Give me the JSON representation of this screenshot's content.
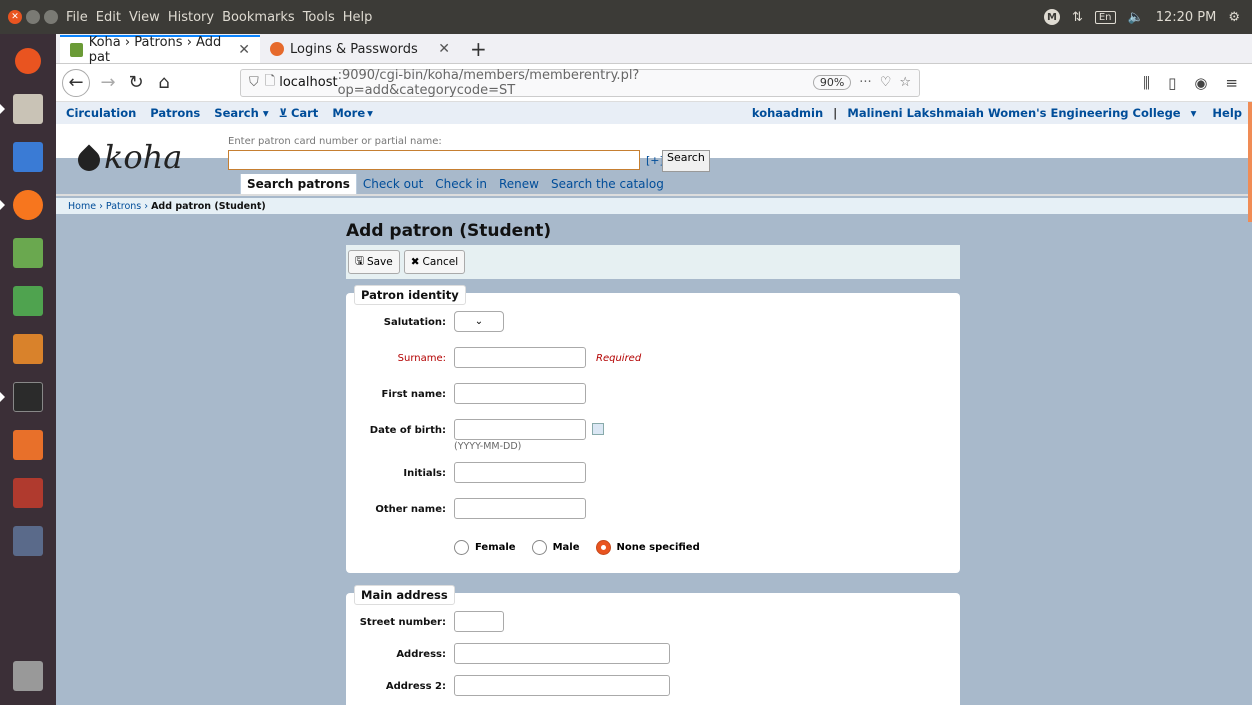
{
  "os": {
    "menus": [
      "File",
      "Edit",
      "View",
      "History",
      "Bookmarks",
      "Tools",
      "Help"
    ],
    "tray": {
      "m": "M",
      "lang": "En",
      "clock": "12:20 PM"
    }
  },
  "browser": {
    "tabs": [
      {
        "title": "Koha › Patrons › Add pat",
        "active": true
      },
      {
        "title": "Logins & Passwords",
        "active": false
      }
    ],
    "url_host": "localhost",
    "url_path": ":9090/cgi-bin/koha/members/memberentry.pl?op=add&categorycode=ST",
    "zoom": "90%"
  },
  "koha": {
    "nav": {
      "circulation": "Circulation",
      "patrons": "Patrons",
      "search": "Search",
      "cart": "Cart",
      "more": "More",
      "user": "kohaadmin",
      "library": "Malineni Lakshmaiah Women's Engineering College",
      "help": "Help"
    },
    "logo": "koha",
    "search_label": "Enter patron card number or partial name:",
    "plus": "[+]",
    "search_button": "Search",
    "subtabs": [
      "Search patrons",
      "Check out",
      "Check in",
      "Renew",
      "Search the catalog"
    ],
    "breadcrumbs": {
      "home": "Home",
      "patrons": "Patrons",
      "current": "Add patron (Student)"
    },
    "page_title": "Add patron (Student)",
    "toolbar": {
      "save": "Save",
      "cancel": "Cancel"
    },
    "identity": {
      "legend": "Patron identity",
      "salutation": "Salutation:",
      "surname": "Surname:",
      "required": "Required",
      "firstname": "First name:",
      "dob": "Date of birth:",
      "dob_hint": "(YYYY-MM-DD)",
      "initials": "Initials:",
      "othername": "Other name:",
      "gender": [
        "Female",
        "Male",
        "None specified"
      ],
      "gender_selected": "None specified"
    },
    "address": {
      "legend": "Main address",
      "street_number": "Street number:",
      "address": "Address:",
      "address2": "Address 2:"
    }
  }
}
